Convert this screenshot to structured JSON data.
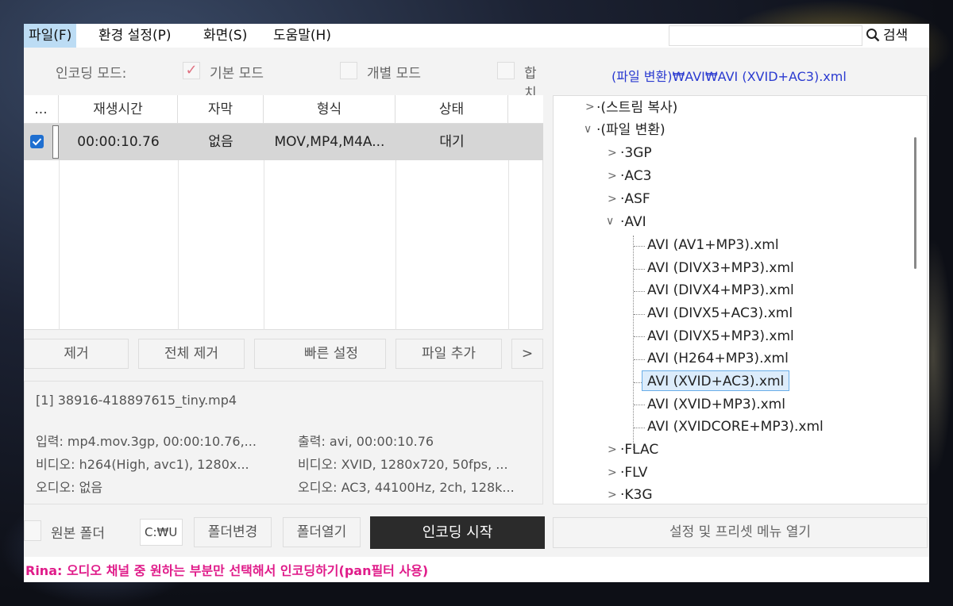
{
  "menu": {
    "items": [
      "파일(F)",
      "환경 설정(P)",
      "화면(S)",
      "도움말(H)"
    ],
    "search_label": "검색",
    "search_value": ""
  },
  "mode": {
    "label": "인코딩 모드:",
    "options": [
      {
        "label": "기본 모드",
        "checked": true
      },
      {
        "label": "개별 모드",
        "checked": false
      },
      {
        "label": "합치",
        "checked": false
      }
    ]
  },
  "preset_path": "(파일 변환)₩AVI₩AVI (XVID+AC3).xml",
  "table": {
    "headers": [
      "...",
      "재생시간",
      "자막",
      "형식",
      "상태"
    ],
    "rows": [
      {
        "checked": true,
        "duration": "00:00:10.76",
        "subtitle": "없음",
        "format": "MOV,MP4,M4A...",
        "status": "대기"
      }
    ]
  },
  "buttons": {
    "remove": "제거",
    "remove_all": "전체 제거",
    "quick_settings": "빠른 설정",
    "add_file": "파일 추가",
    "more": ">"
  },
  "info": {
    "filename": "[1] 38916-418897615_tiny.mp4",
    "input": "입력: mp4.mov.3gp, 00:00:10.76,...",
    "output": "출력: avi, 00:00:10.76",
    "video_in": "비디오: h264(High, avc1), 1280x...",
    "video_out": "비디오: XVID, 1280x720, 50fps, ...",
    "audio_in": "오디오: 없음",
    "audio_out": "오디오: AC3, 44100Hz, 2ch, 128k..."
  },
  "bottom": {
    "source_folder_label": "원본 폴더",
    "path_value": "C:₩U",
    "change_folder": "폴더변경",
    "open_folder": "폴더열기",
    "start": "인코딩 시작",
    "settings_menu": "설정 및 프리셋 메뉴 열기"
  },
  "status_text": "Rina: 오디오 채널 중 원하는 부분만 선택해서 인코딩하기(pan필터 사용)",
  "tree": {
    "stream_copy": "(스트림 복사)",
    "file_convert": "(파일 변환)",
    "formats_before": [
      "3GP",
      "AC3",
      "ASF"
    ],
    "avi": "AVI",
    "avi_presets": [
      "AVI (AV1+MP3).xml",
      "AVI (DIVX3+MP3).xml",
      "AVI (DIVX4+MP3).xml",
      "AVI (DIVX5+AC3).xml",
      "AVI (DIVX5+MP3).xml",
      "AVI (H264+MP3).xml",
      "AVI (XVID+AC3).xml",
      "AVI (XVID+MP3).xml",
      "AVI (XVIDCORE+MP3).xml"
    ],
    "selected_index": 6,
    "formats_after": [
      "FLAC",
      "FLV",
      "K3G"
    ]
  },
  "colors": {
    "start_button_bg": "#2b2b2b",
    "status_text": "#e01c8a",
    "preset_path": "#2a3ad0",
    "selection_border": "#6aaee8"
  }
}
